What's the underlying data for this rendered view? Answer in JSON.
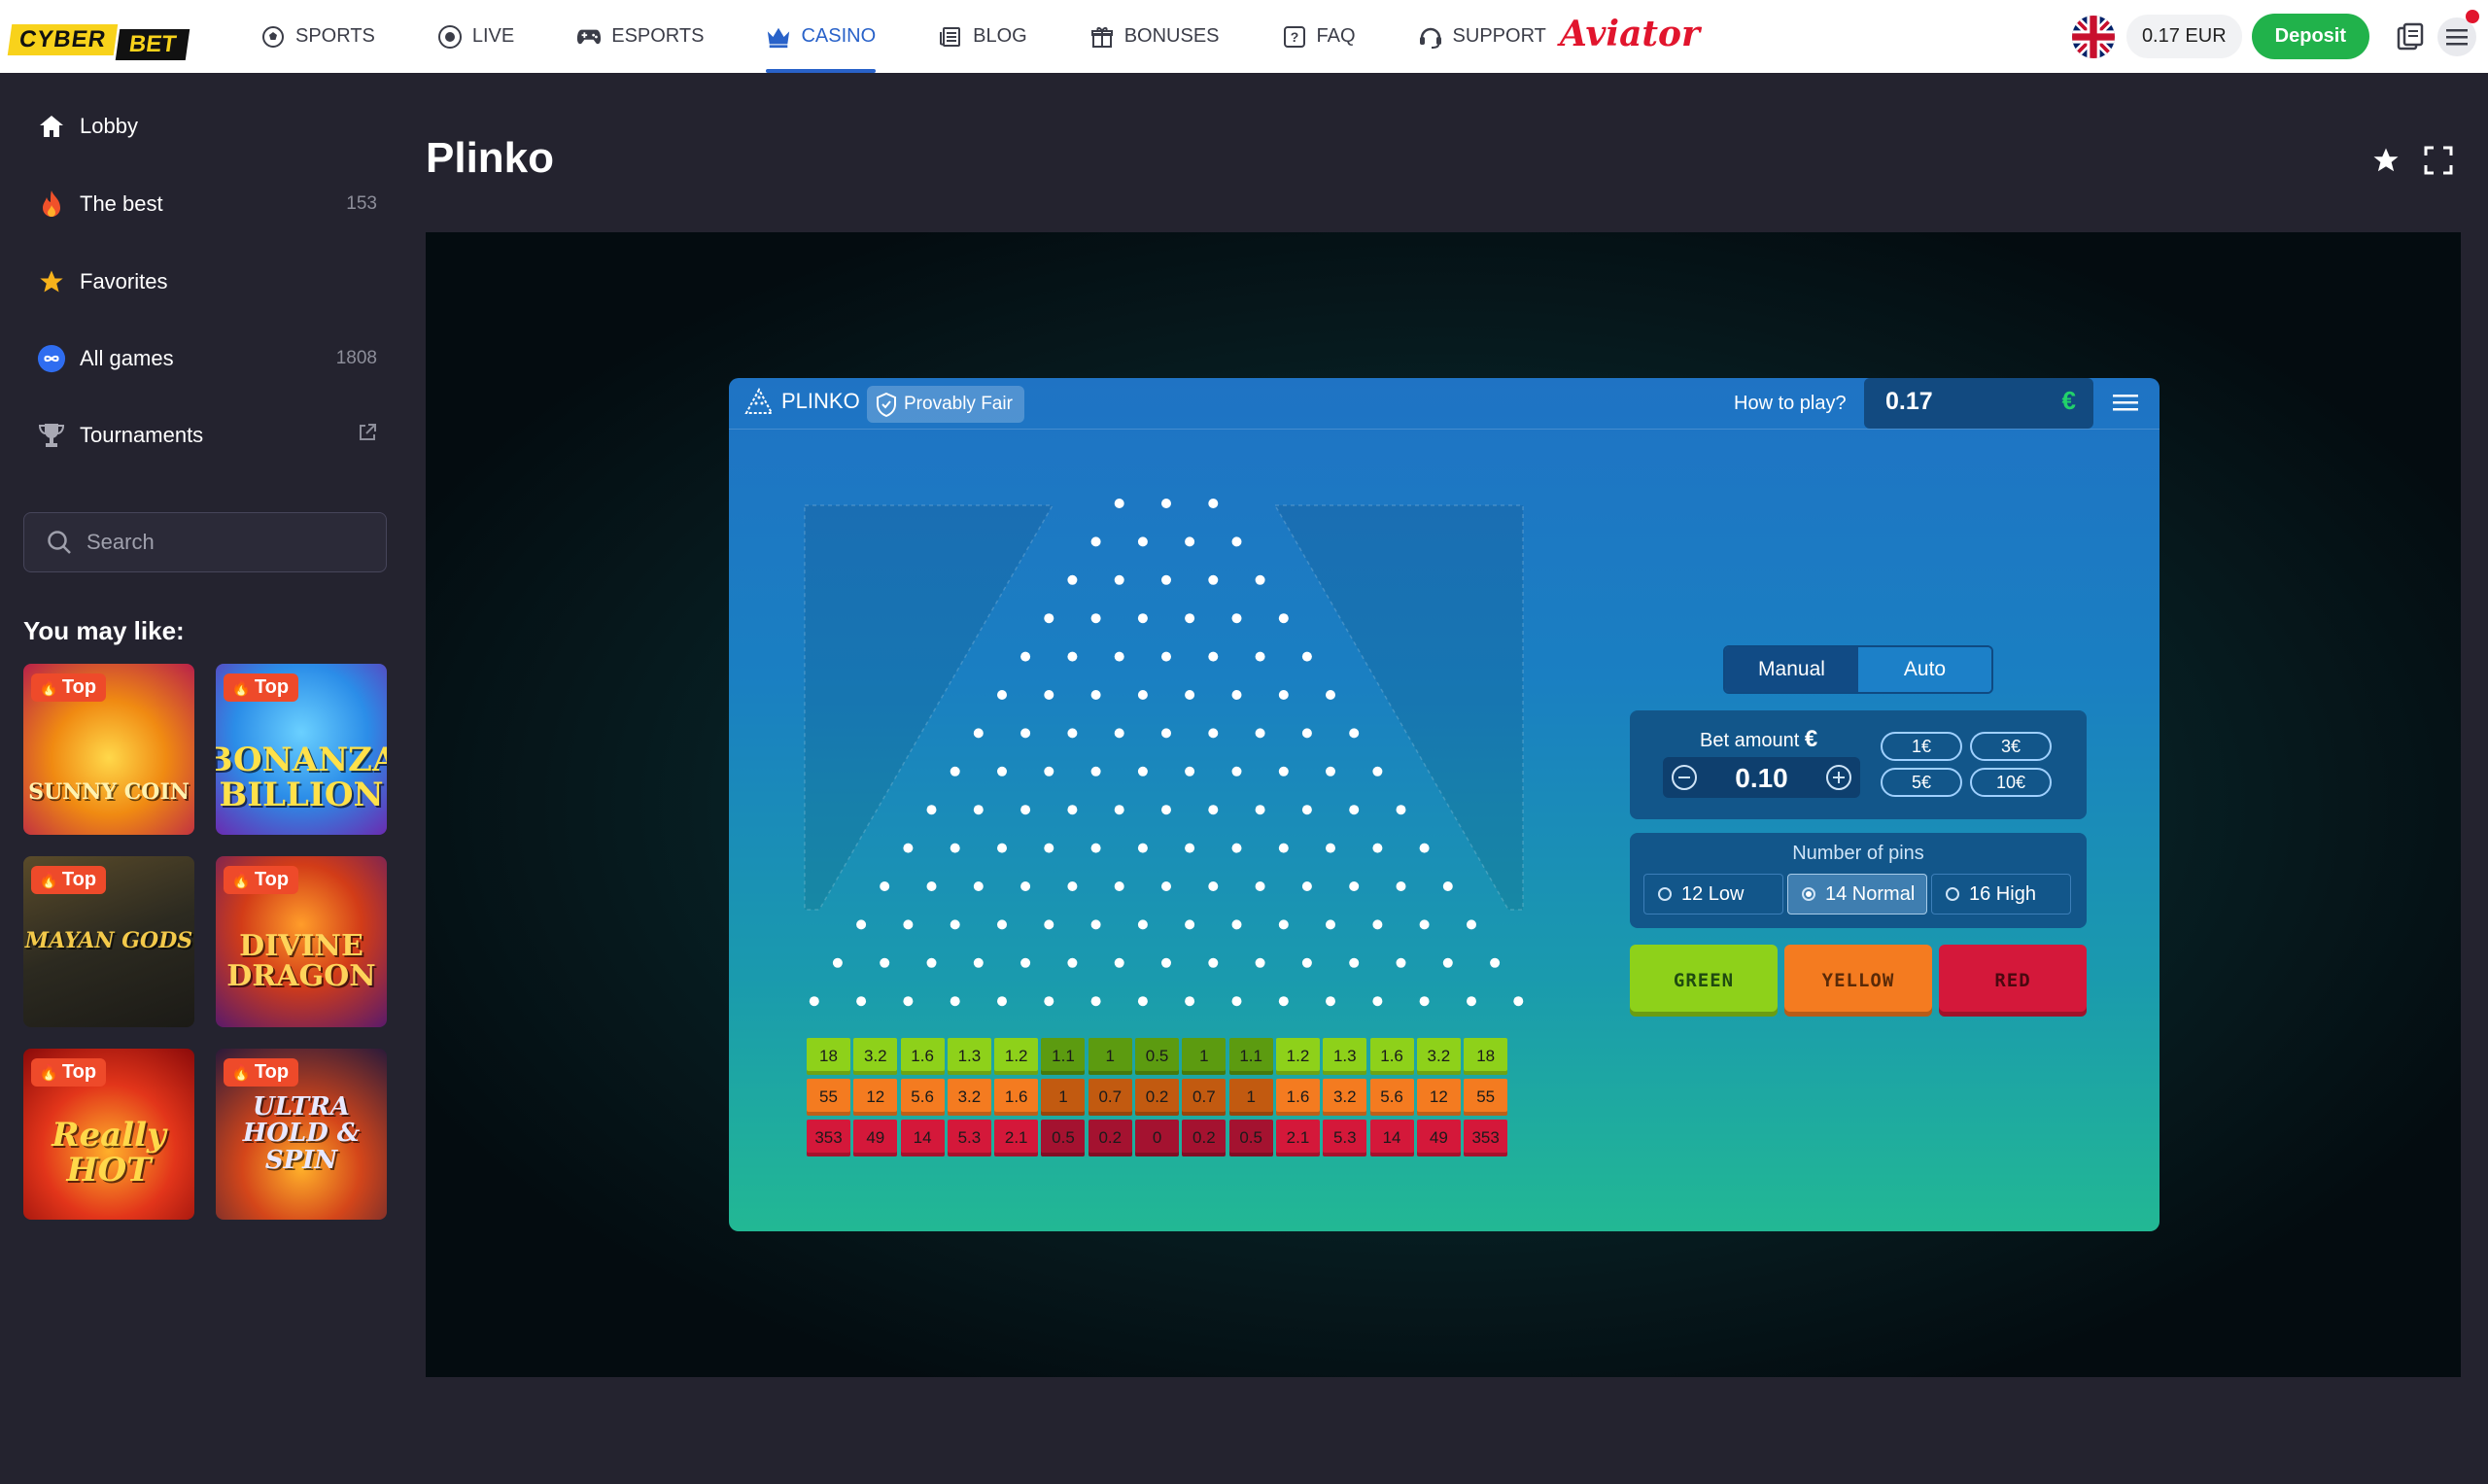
{
  "brand": {
    "word1": "CYBER",
    "word2": "BET"
  },
  "nav": [
    {
      "label": "SPORTS",
      "icon": "soccer-ball-icon",
      "active": false
    },
    {
      "label": "LIVE",
      "icon": "live-icon",
      "active": false
    },
    {
      "label": "ESPORTS",
      "icon": "gamepad-icon",
      "active": false
    },
    {
      "label": "CASINO",
      "icon": "crown-icon",
      "active": true
    },
    {
      "label": "BLOG",
      "icon": "newspaper-icon",
      "active": false
    },
    {
      "label": "BONUSES",
      "icon": "gift-icon",
      "active": false
    },
    {
      "label": "FAQ",
      "icon": "question-icon",
      "active": false
    },
    {
      "label": "SUPPORT",
      "icon": "headset-icon",
      "active": false
    }
  ],
  "aviator_label": "Aviator",
  "account": {
    "balance": "0.17 EUR",
    "deposit_label": "Deposit"
  },
  "sidebar": {
    "items": [
      {
        "label": "Lobby",
        "icon": "home-icon",
        "count": ""
      },
      {
        "label": "The best",
        "icon": "fire-icon",
        "count": "153"
      },
      {
        "label": "Favorites",
        "icon": "star-icon",
        "count": ""
      },
      {
        "label": "All games",
        "icon": "infinity-icon",
        "count": "1808"
      },
      {
        "label": "Tournaments",
        "icon": "trophy-icon",
        "count": ""
      }
    ],
    "search_placeholder": "Search",
    "you_may_like": "You may like:",
    "badge_label": "Top",
    "games": [
      {
        "title": "SUNNY COIN"
      },
      {
        "title": "BONANZA BILLION"
      },
      {
        "title": "MAYAN GODS"
      },
      {
        "title": "DIVINE DRAGON"
      },
      {
        "title": "Really HOT"
      },
      {
        "title": "ULTRA HOLD & SPIN"
      }
    ]
  },
  "page": {
    "title": "Plinko"
  },
  "game": {
    "name": "PLINKO",
    "provably_fair": "Provably Fair",
    "how_to_play": "How to play?",
    "balance": "0.17",
    "currency": "€",
    "mode_tabs": [
      "Manual",
      "Auto"
    ],
    "active_mode": "Manual",
    "bet_label": "Bet amount",
    "bet_currency": "€",
    "bet_value": "0.10",
    "quick_bets": [
      "1€",
      "3€",
      "5€",
      "10€"
    ],
    "pins_label": "Number of pins",
    "pin_options": [
      "12 Low",
      "14 Normal",
      "16 High"
    ],
    "selected_pins": "14 Normal",
    "color_buttons": [
      "GREEN",
      "YELLOW",
      "RED"
    ],
    "multipliers": {
      "green": [
        "18",
        "3.2",
        "1.6",
        "1.3",
        "1.2",
        "1.1",
        "1",
        "0.5",
        "1",
        "1.1",
        "1.2",
        "1.3",
        "1.6",
        "3.2",
        "18"
      ],
      "yellow": [
        "55",
        "12",
        "5.6",
        "3.2",
        "1.6",
        "1",
        "0.7",
        "0.2",
        "0.7",
        "1",
        "1.6",
        "3.2",
        "5.6",
        "12",
        "55"
      ],
      "red": [
        "353",
        "49",
        "14",
        "5.3",
        "2.1",
        "0.5",
        "0.2",
        "0",
        "0.2",
        "0.5",
        "2.1",
        "5.3",
        "14",
        "49",
        "353"
      ]
    },
    "colors": {
      "green": "#8ed11a",
      "yellow": "#f47b20",
      "red": "#d4183a"
    }
  }
}
